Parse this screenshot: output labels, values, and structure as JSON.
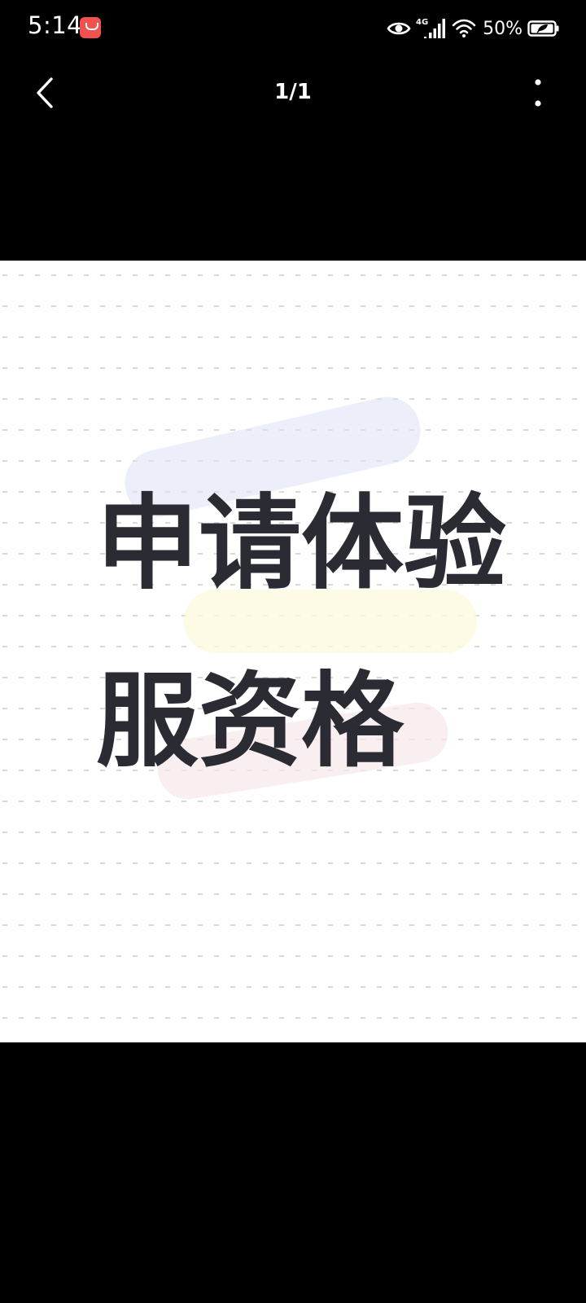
{
  "status_bar": {
    "time": "5:14",
    "network": "4G",
    "battery_percent": "50%",
    "icons": [
      "app-notification-icon",
      "eye-icon",
      "signal-icon",
      "wifi-icon",
      "battery-icon"
    ]
  },
  "nav": {
    "back_icon": "chevron-left-icon",
    "counter": "1/1",
    "more_icon": "more-vertical-icon"
  },
  "image": {
    "line1": "申请体验",
    "line2": "服资格"
  },
  "colors": {
    "background": "#000000",
    "image_background": "#ffffff",
    "headline_text": "#2a2b33",
    "badge": "#f0524f"
  }
}
